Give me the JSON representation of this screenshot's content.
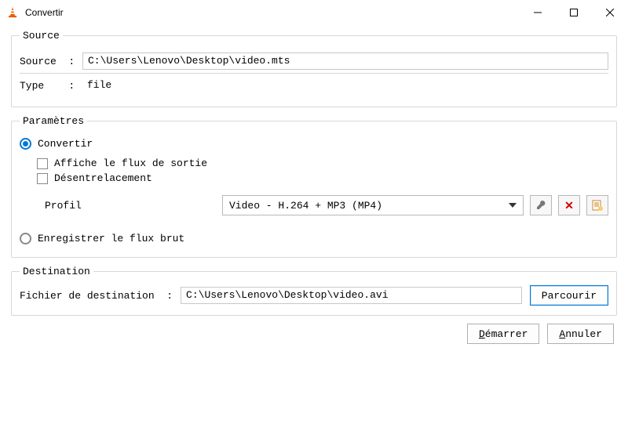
{
  "window": {
    "title": "Convertir"
  },
  "source": {
    "legend": "Source",
    "source_label": "Source  :",
    "source_value": "C:\\Users\\Lenovo\\Desktop\\video.mts",
    "type_label": "Type    :",
    "type_value": "file"
  },
  "params": {
    "legend": "Paramètres",
    "convert_label": "Convertir",
    "show_output_label": "Affiche le flux de sortie",
    "deinterlace_label": "Désentrelacement",
    "profile_label": "Profil",
    "profile_value": "Video - H.264 + MP3 (MP4)",
    "raw_label": "Enregistrer le flux brut"
  },
  "destination": {
    "legend": "Destination",
    "file_label": "Fichier de destination  :",
    "file_value": "C:\\Users\\Lenovo\\Desktop\\video.avi",
    "browse_label": "Parcourir"
  },
  "footer": {
    "start_label": "Démarrer",
    "cancel_label": "Annuler"
  }
}
